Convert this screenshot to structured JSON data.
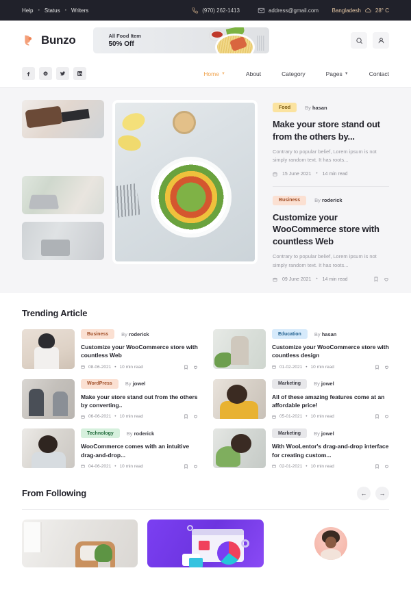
{
  "topbar": {
    "links": [
      "Help",
      "Status",
      "Writers"
    ],
    "phone": "(970) 262-1413",
    "email": "address@gmail.com",
    "location": "Bangladesh",
    "temperature": "28° C",
    "phone_icon": "phone-icon",
    "email_icon": "envelope-icon",
    "weather_icon": "cloud-icon"
  },
  "header": {
    "logo_text": "Bunzo",
    "promo_line1": "All Food Item",
    "promo_line2": "50% Off",
    "search_icon": "search-icon",
    "account_icon": "user-icon"
  },
  "nav": {
    "socials": [
      "facebook-icon",
      "behance-icon",
      "twitter-icon",
      "linkedin-icon"
    ],
    "menu": [
      {
        "label": "Home",
        "has_caret": true,
        "active": true
      },
      {
        "label": "About",
        "has_caret": false,
        "active": false
      },
      {
        "label": "Category",
        "has_caret": false,
        "active": false
      },
      {
        "label": "Pages",
        "has_caret": true,
        "active": false
      },
      {
        "label": "Contact",
        "has_caret": false,
        "active": false
      }
    ]
  },
  "hero": {
    "thumbnails": [
      "smartwatch-photo",
      "man-with-laptop-photo",
      "woman-at-desk-photo"
    ],
    "main_image": "salad-bowl-photo",
    "posts": [
      {
        "badge": "Food",
        "badge_bg": "#fbe3a0",
        "badge_color": "#7a5a12",
        "by_prefix": "By ",
        "author": "hasan",
        "title": "Make your store stand out from the others by...",
        "excerpt": "Contrary to popular belief, Lorem ipsum is not simply random text. It has roots...",
        "date": "15 June 2021",
        "read_time": "14 min read"
      },
      {
        "badge": "Business",
        "badge_bg": "#fbe0d2",
        "badge_color": "#a14f28",
        "by_prefix": "By ",
        "author": "roderick",
        "title": "Customize your WooCommerce store with countless Web",
        "excerpt": "Contrary to popular belief, Lorem ipsum is not simply random text. It has roots...",
        "date": "09 June 2021",
        "read_time": "14 min read"
      }
    ]
  },
  "trending": {
    "title": "Trending Article",
    "cards": [
      {
        "thumb": "dancing-person-photo",
        "thumb_class": "bg-dance",
        "badge": "Business",
        "badge_bg": "#fbe0d2",
        "badge_color": "#a14f28",
        "by_prefix": "By ",
        "author": "roderick",
        "title": "Customize your WooCommerce store with countless Web",
        "date": "08-06-2021",
        "read_time": "10 min read"
      },
      {
        "thumb": "meditating-woman-photo",
        "thumb_class": "bg-yoga",
        "badge": "Education",
        "badge_bg": "#d6eafb",
        "badge_color": "#205f8e",
        "by_prefix": "By ",
        "author": "hasan",
        "title": "Customize your WooCommerce store with countless design",
        "date": "01-02-2021",
        "read_time": "10 min read"
      },
      {
        "thumb": "couple-photo",
        "thumb_class": "bg-couple",
        "badge": "WordPress",
        "badge_bg": "#fbe0d2",
        "badge_color": "#a14f28",
        "by_prefix": "By ",
        "author": "jowel",
        "title": "Make your store stand out from the others by converting..",
        "date": "06-06-2021",
        "read_time": "10 min read"
      },
      {
        "thumb": "woman-reading-photo",
        "thumb_class": "bg-reading",
        "badge": "Marketing",
        "badge_bg": "#e7e7ea",
        "badge_color": "#3c3c44",
        "by_prefix": "By ",
        "author": "jowel",
        "title": "All of these amazing features come at an affordable price!",
        "date": "05-01-2021",
        "read_time": "10 min read"
      },
      {
        "thumb": "woman-office-photo",
        "thumb_class": "bg-office",
        "badge": "Technology",
        "badge_bg": "#d6f0dd",
        "badge_color": "#226b3c",
        "by_prefix": "By ",
        "author": "roderick",
        "title": "WooCommerce comes with an intuitive drag-and-drop...",
        "date": "04-06-2021",
        "read_time": "10 min read"
      },
      {
        "thumb": "girl-with-flowers-photo",
        "thumb_class": "bg-girl",
        "badge": "Marketing",
        "badge_bg": "#e7e7ea",
        "badge_color": "#3c3c44",
        "by_prefix": "By ",
        "author": "jowel",
        "title": "With WooLentor's drag-and-drop interface for creating custom...",
        "date": "02-01-2021",
        "read_time": "10 min read"
      }
    ]
  },
  "following": {
    "title": "From Following",
    "prev_icon": "arrow-left-icon",
    "next_icon": "arrow-right-icon",
    "prev_label": "←",
    "next_label": "→",
    "cards": [
      "living-room-photo",
      "purple-illustration",
      "author-avatar"
    ]
  },
  "icons": {
    "bookmark": "bookmark-icon",
    "heart": "heart-icon",
    "calendar": "calendar-icon",
    "dot": "•"
  }
}
